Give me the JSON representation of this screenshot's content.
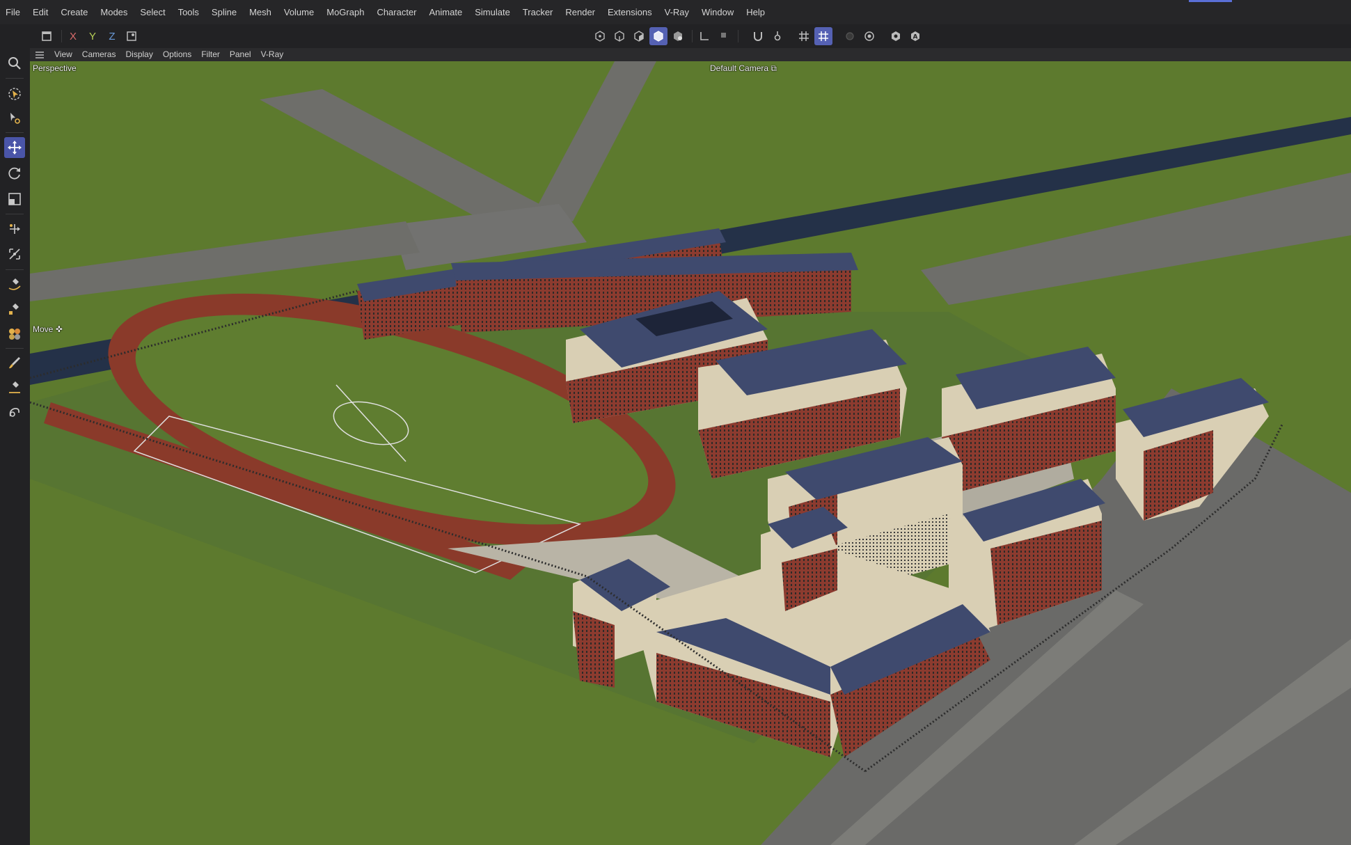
{
  "menubar": {
    "items": [
      "File",
      "Edit",
      "Create",
      "Modes",
      "Select",
      "Tools",
      "Spline",
      "Mesh",
      "Volume",
      "MoGraph",
      "Character",
      "Animate",
      "Simulate",
      "Tracker",
      "Render",
      "Extensions",
      "V-Ray",
      "Window",
      "Help"
    ]
  },
  "toolbar": {
    "axis_x": "X",
    "axis_y": "Y",
    "axis_z": "Z"
  },
  "viewport_menu": {
    "items": [
      "View",
      "Cameras",
      "Display",
      "Options",
      "Filter",
      "Panel",
      "V-Ray"
    ]
  },
  "viewport": {
    "view_name": "Perspective",
    "camera_label": "Default Camera",
    "tool_label": "Move"
  },
  "colors": {
    "accent": "#5561b3",
    "grass": "#5d7a2e",
    "track": "#8a3a2a",
    "brick": "#8c3b2f",
    "roof": "#3f4a6e"
  }
}
